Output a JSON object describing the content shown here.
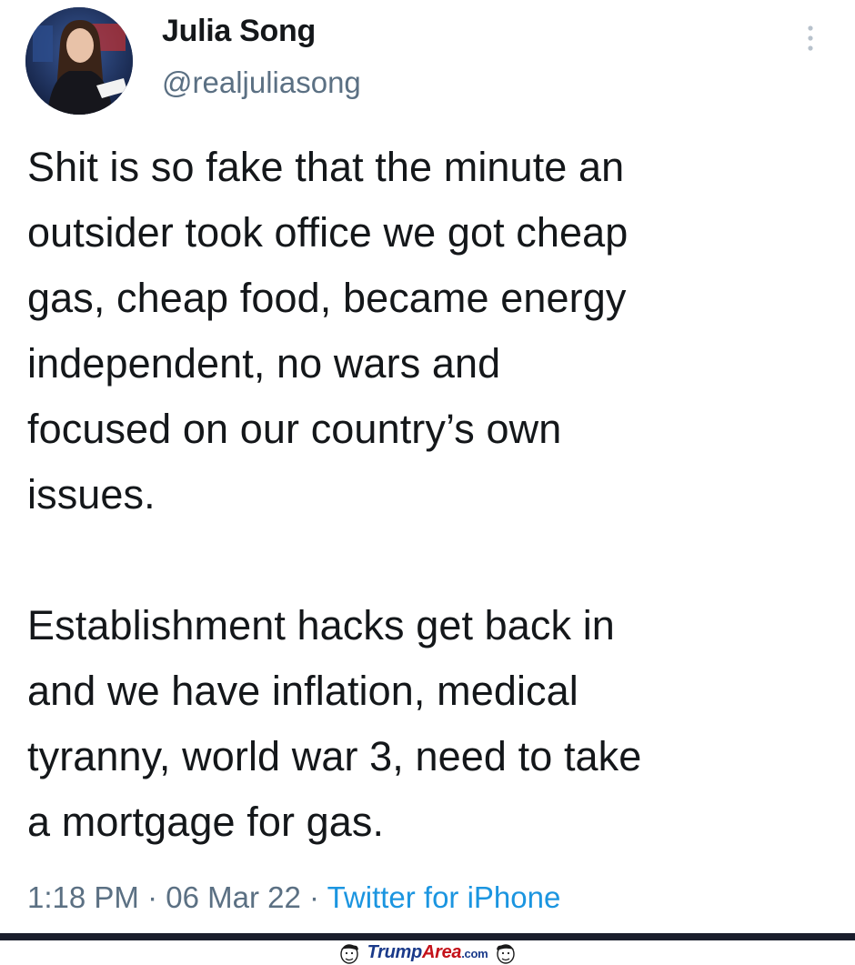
{
  "author": {
    "name": "Julia Song",
    "handle": "@realjuliasong",
    "avatar_icon": "profile-photo"
  },
  "menu": {
    "icon": "more-vertical-icon"
  },
  "tweet": {
    "paragraph_1": "Shit is so fake that the minute an\noutsider took office we got cheap\ngas, cheap food, became energy\nindependent, no wars and\nfocused on our country’s own\nissues.",
    "paragraph_2": "Establishment hacks get back in\nand we have inflation, medical\ntyranny, world war 3, need to take\na mortgage for gas."
  },
  "meta": {
    "time": "1:18 PM",
    "separator": " · ",
    "date": "06 Mar 22",
    "source": "Twitter for iPhone"
  },
  "watermark": {
    "part1": "Trump",
    "part2": "Area",
    "part3": ".com"
  },
  "colors": {
    "text": "#14171a",
    "secondary": "#5b7083",
    "link": "#1b95e0",
    "bar": "#1a1e2c"
  }
}
